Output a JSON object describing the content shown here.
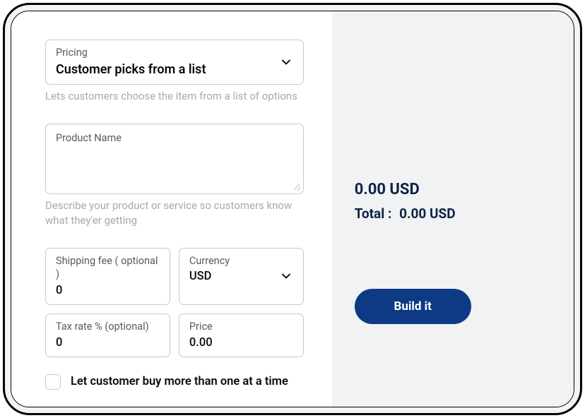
{
  "pricing": {
    "label": "Pricing",
    "value": "Customer picks from a list",
    "hint": "Lets customers choose the item from a list of options"
  },
  "product": {
    "placeholder": "Product Name",
    "hint": "Describe your product or service so customers know what they'er getting"
  },
  "shipping": {
    "label": "Shipping fee ( optional )",
    "value": "0"
  },
  "currency": {
    "label": "Currency",
    "value": "USD"
  },
  "tax": {
    "label": "Tax rate %  (optional)",
    "value": "0"
  },
  "price": {
    "label": "Price",
    "value": "0.00"
  },
  "multi_checkbox": {
    "label": "Let customer buy more than one at a time"
  },
  "summary": {
    "amount": "0.00 USD",
    "total_label": "Total :",
    "total_value": "0.00 USD"
  },
  "build_button": "Build it"
}
